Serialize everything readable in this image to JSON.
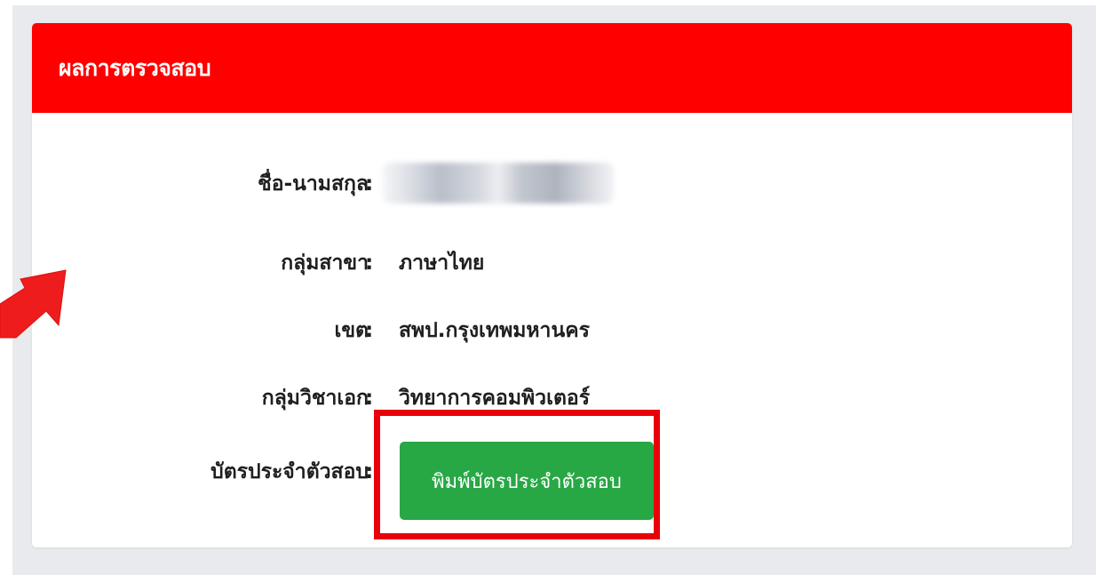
{
  "header": {
    "title": "ผลการตรวจสอบ"
  },
  "fields": [
    {
      "label": "ชื่อ-นามสกุล",
      "colon": ":",
      "value": ""
    },
    {
      "label": "กลุ่มสาขา",
      "colon": ":",
      "value": "ภาษาไทย"
    },
    {
      "label": "เขต",
      "colon": ":",
      "value": "สพป.กรุงเทพมหานคร"
    },
    {
      "label": "กลุ่มวิชาเอก",
      "colon": ":",
      "value": "วิทยาการคอมพิวเตอร์"
    },
    {
      "label": "บัตรประจำตัวสอบ",
      "colon": ":"
    }
  ],
  "print_button": {
    "label": "พิมพ์บัตรประจำตัวสอบ"
  },
  "colors": {
    "header": "#ff0000",
    "button": "#28a745",
    "highlight": "#e8000b",
    "arrow": "#ee1c1c",
    "background": "#e8eaed"
  }
}
